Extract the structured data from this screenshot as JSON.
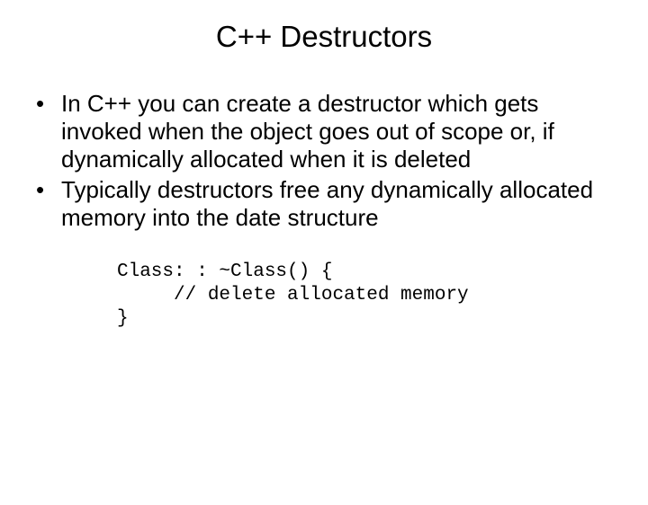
{
  "title": "C++ Destructors",
  "bullets": [
    "In C++ you can create a destructor which gets invoked when the object goes out of scope or, if dynamically allocated when it is deleted",
    "Typically destructors free any dynamically allocated memory into the date structure"
  ],
  "code": "Class: : ~Class() {\n     // delete allocated memory\n}"
}
